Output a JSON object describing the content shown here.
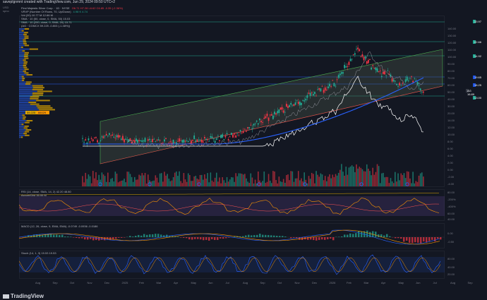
{
  "header": {
    "caption": "saveplgnmnt created with TradingView.com, Jun 29, 2024 09:50 UTC+2",
    "currency": "USD",
    "currency_sub": "spno"
  },
  "legend": {
    "title": "First Majestic Silver Corp. · 1D · NYSE",
    "ohlc": "O6.71  H7.28  L6.62  C6.85  -0.35 (-2.36%)",
    "vrvp": "VRVP (Number Of Rows, 70, Up/Down)",
    "vrvp_vals": "4.98 K  4.74",
    "vol": "Vol (20)  10.77 M  12.66 M",
    "sma1": "SMA · 10 (50, close, 0, SMA, 50)  15.03",
    "sma2": "SMA · 10 (200, close, 0, SMA, 20)  15.71",
    "ind": "(AG · CGMCX  59.225  -0.803 (-1.48%))"
  },
  "price_axis": [
    "140.00",
    "130.00",
    "120.00",
    "110.00",
    "100.00",
    "90.00",
    "80.00",
    "70.00",
    "60.00",
    "50.00",
    "40.00",
    "30.00",
    "20.00",
    "14.00",
    "12.00",
    "10.00",
    "8.00",
    "6.00",
    "4.00",
    "2.00",
    "0.00",
    "-2.00",
    "-4.00"
  ],
  "price_tags": [
    {
      "label": "33.97",
      "color": "#22ab94"
    },
    {
      "label": "22.66",
      "color": "#22ab94"
    },
    {
      "label": "14.92",
      "color": "#22ab94"
    },
    {
      "label": "19.65",
      "color": "#1e53e5"
    },
    {
      "label": "18.25",
      "color": "#1e53e5"
    },
    {
      "label": "AG  16.89",
      "color": "#ffffff"
    },
    {
      "label": "13.00",
      "color": "#22ab94"
    }
  ],
  "vrvp_tag": "59.225",
  "vrvp_tag2": "66029",
  "rsi": {
    "label": "RSI (14, close, SMA, 14, 2)  42.20  48.80",
    "sub": "Accum/Dist  35.55 M",
    "axis": [
      "80.00",
      "-200%",
      "-400%",
      "60.00",
      "40.00"
    ]
  },
  "macd": {
    "label": "MACD (12, 26, close, 9, EMA, EMA)  -0.0749  -0.0936  -0.0186",
    "axis": [
      "0.00",
      "-0.50"
    ]
  },
  "stoch": {
    "label": "Stoch (14, 1, 3)  19.53  19.53",
    "axis": [
      "80.00",
      "40.00",
      "20.00"
    ]
  },
  "time_axis": [
    "Aug",
    "Sep",
    "Oct",
    "Nov",
    "Dec",
    "2025",
    "Feb",
    "Mar",
    "Apr",
    "May",
    "Jun",
    "Jul",
    "Aug",
    "Sep",
    "Oct",
    "Nov",
    "Dec",
    "2026",
    "Feb",
    "Mar",
    "Apr",
    "May",
    "Jun",
    "Jul",
    "Aug",
    "Sep"
  ],
  "brand": "TradingView",
  "colors": {
    "bg": "#131722",
    "up": "#22ab94",
    "down": "#f23645",
    "sma50": "#2962ff",
    "line_white": "#ffffff",
    "channel": "#4caf50",
    "rsi_bg": "#7e57c2",
    "orange": "#ff9800"
  }
}
